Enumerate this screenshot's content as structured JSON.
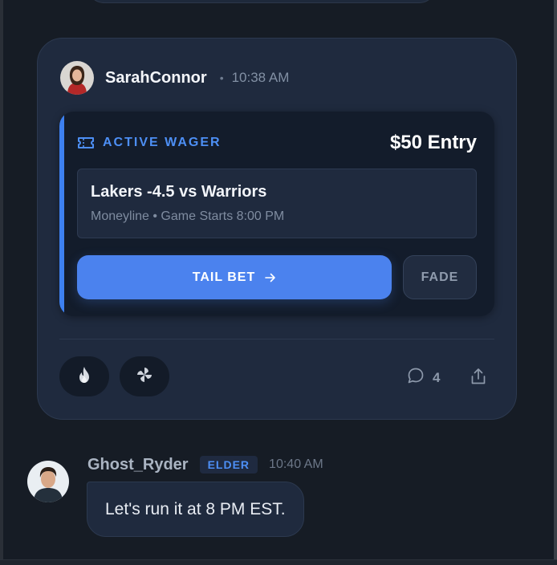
{
  "post": {
    "username": "SarahConnor",
    "separator": "•",
    "time": "10:38 AM",
    "avatar_icon": "user-avatar-photo",
    "wager": {
      "tag": "ACTIVE WAGER",
      "entry": "$50 Entry",
      "icon": "ticket-icon",
      "bet_title": "Lakers -4.5 vs Warriors",
      "bet_subtitle": "Moneyline • Game Starts 8:00 PM",
      "tail_label": "TAIL BET",
      "fade_label": "FADE"
    },
    "reactions": [
      {
        "icon": "fire-icon"
      },
      {
        "icon": "pinwheel-icon"
      }
    ],
    "comment_count": "4",
    "share_icon": "share-icon"
  },
  "reply": {
    "username": "Ghost_Ryder",
    "badge": "ELDER",
    "time": "10:40 AM",
    "message": "Let's run it at 8 PM EST."
  },
  "colors": {
    "background": "#161c25",
    "card": "#1f2a3e",
    "accent": "#4b82ee",
    "wager_tag": "#4d8ff5"
  }
}
